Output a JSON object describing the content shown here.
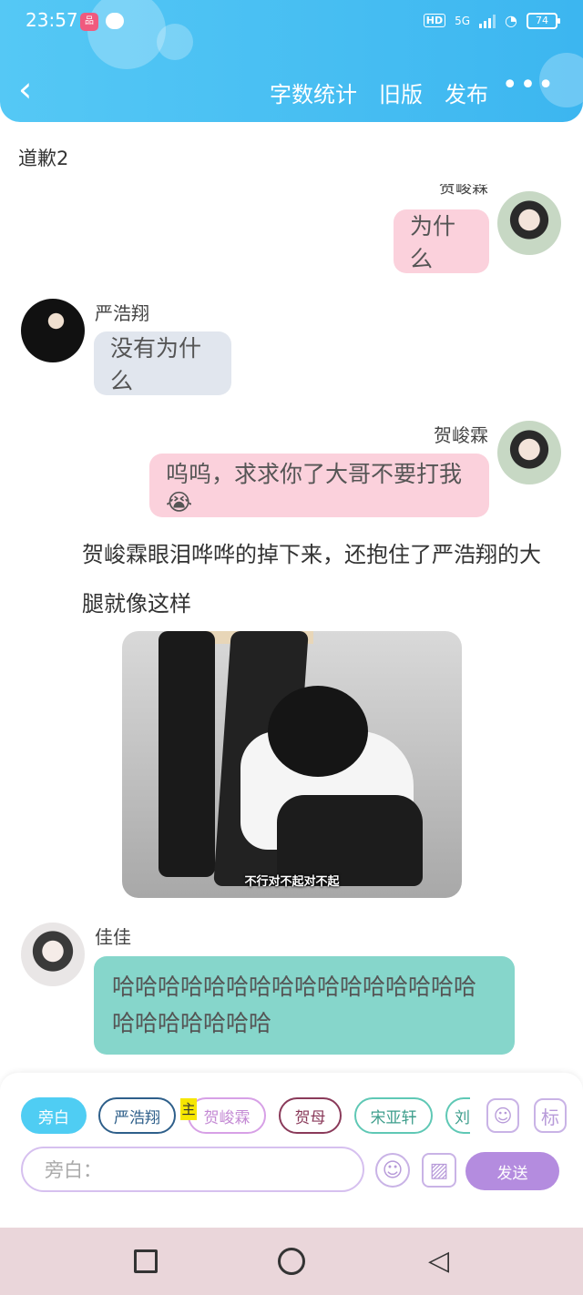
{
  "status_bar": {
    "time": "23:57",
    "network": "5G",
    "battery": "74"
  },
  "nav": {
    "back": "‹",
    "actions": [
      "字数统计",
      "旧版",
      "发布"
    ],
    "more": "•••"
  },
  "doc_title": "道歉2",
  "messages": {
    "m0_name": "贺峻霖",
    "m0_text": "为什么",
    "m1_name": "严浩翔",
    "m1_text": "没有为什么",
    "m2_name": "贺峻霖",
    "m2_text": "呜呜，求求你了大哥不要打我😭",
    "narration": "贺峻霖眼泪哗哗的掉下来，还抱住了严浩翔的大腿就像这样",
    "image_caption": "不行对不起对不起",
    "m3_name": "佳佳",
    "m3_text": "哈哈哈哈哈哈哈哈哈哈哈哈哈哈哈哈哈哈哈哈哈哈哈"
  },
  "characters": [
    "旁白",
    "严浩翔",
    "贺峻霖",
    "贺母",
    "宋亚轩",
    "刘"
  ],
  "badge": "主",
  "side_icons": {
    "tag": "标"
  },
  "input": {
    "placeholder": "旁白：",
    "send": "发送"
  },
  "colors": {
    "header": "#3cb6f0",
    "pink_bubble": "#fbd1dc",
    "grey_bubble": "#e1e6ee",
    "teal_bubble": "#86d6cb",
    "send": "#b48cdf"
  }
}
